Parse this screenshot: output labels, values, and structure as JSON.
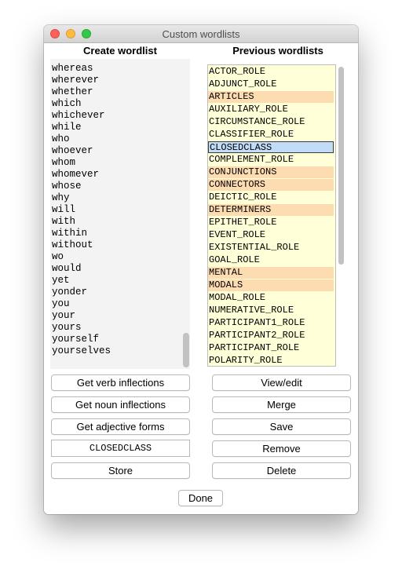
{
  "window": {
    "title": "Custom wordlists"
  },
  "left": {
    "header": "Create wordlist",
    "words": [
      "whereas",
      "wherever",
      "whether",
      "which",
      "whichever",
      "while",
      "who",
      "whoever",
      "whom",
      "whomever",
      "whose",
      "why",
      "will",
      "with",
      "within",
      "without",
      "wo",
      "would",
      "yet",
      "yonder",
      "you",
      "your",
      "yours",
      "yourself",
      "yourselves"
    ],
    "buttons": {
      "verb": "Get verb inflections",
      "noun": "Get noun inflections",
      "adjective": "Get adjective forms",
      "store": "Store"
    },
    "name_field": {
      "value": "CLOSEDCLASS"
    }
  },
  "right": {
    "header": "Previous wordlists",
    "items": [
      {
        "label": "ACTOR_ROLE",
        "state": "normal"
      },
      {
        "label": "ADJUNCT_ROLE",
        "state": "normal"
      },
      {
        "label": "ARTICLES",
        "state": "highlight"
      },
      {
        "label": "AUXILIARY_ROLE",
        "state": "normal"
      },
      {
        "label": "CIRCUMSTANCE_ROLE",
        "state": "normal"
      },
      {
        "label": "CLASSIFIER_ROLE",
        "state": "normal"
      },
      {
        "label": "CLOSEDCLASS",
        "state": "selected"
      },
      {
        "label": "COMPLEMENT_ROLE",
        "state": "normal"
      },
      {
        "label": "CONJUNCTIONS",
        "state": "highlight"
      },
      {
        "label": "CONNECTORS",
        "state": "highlight"
      },
      {
        "label": "DEICTIC_ROLE",
        "state": "normal"
      },
      {
        "label": "DETERMINERS",
        "state": "highlight"
      },
      {
        "label": "EPITHET_ROLE",
        "state": "normal"
      },
      {
        "label": "EVENT_ROLE",
        "state": "normal"
      },
      {
        "label": "EXISTENTIAL_ROLE",
        "state": "normal"
      },
      {
        "label": "GOAL_ROLE",
        "state": "normal"
      },
      {
        "label": "MENTAL",
        "state": "highlight"
      },
      {
        "label": "MODALS",
        "state": "highlight"
      },
      {
        "label": "MODAL_ROLE",
        "state": "normal"
      },
      {
        "label": "NUMERATIVE_ROLE",
        "state": "normal"
      },
      {
        "label": "PARTICIPANT1_ROLE",
        "state": "normal"
      },
      {
        "label": "PARTICIPANT2_ROLE",
        "state": "normal"
      },
      {
        "label": "PARTICIPANT_ROLE",
        "state": "normal"
      },
      {
        "label": "POLARITY_ROLE",
        "state": "normal"
      }
    ],
    "buttons": {
      "view": "View/edit",
      "merge": "Merge",
      "save": "Save",
      "remove": "Remove",
      "delete": "Delete"
    }
  },
  "done_label": "Done",
  "colors": {
    "list_bg": "#ffffd8",
    "highlight": "#fddcb1",
    "selected": "#c2dcf7"
  }
}
